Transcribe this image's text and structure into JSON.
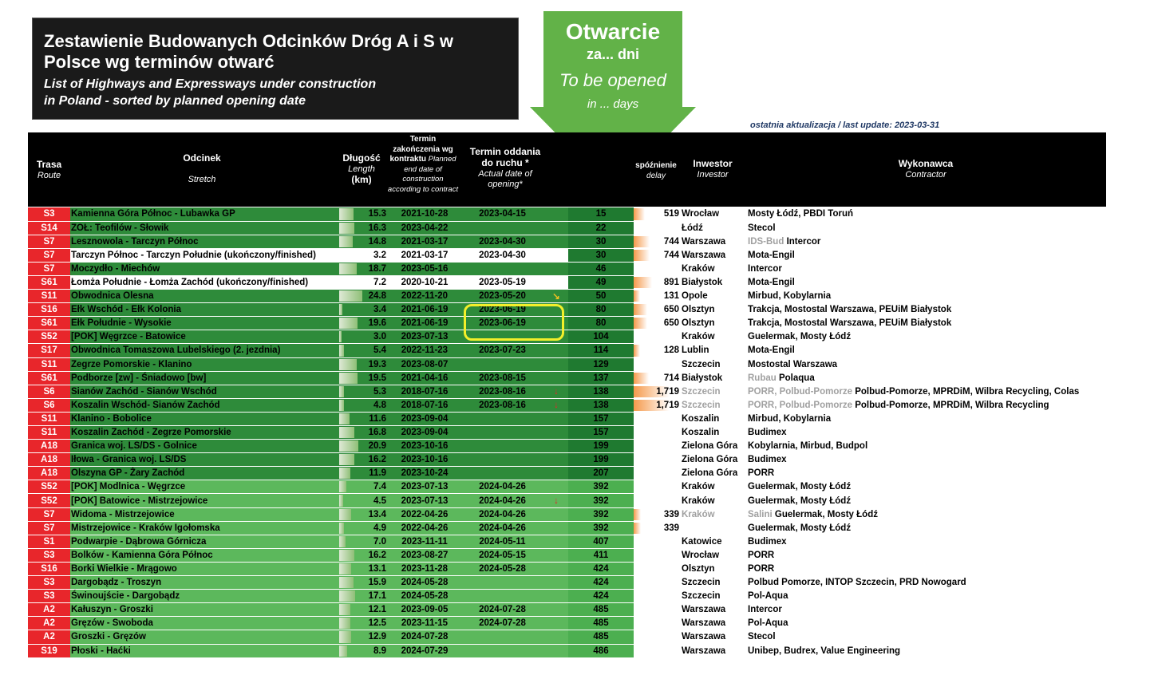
{
  "title": {
    "pl": "Zestawienie Budowanych Odcinków Dróg A i S w Polsce wg terminów otwarć",
    "en_line1": "List of Highways and Expressways under construction",
    "en_line2": "in Poland - sorted by planned opening date"
  },
  "arrow": {
    "line1": "Otwarcie",
    "line2": "za... dni",
    "line3": "To be opened",
    "line4": "in ... days"
  },
  "last_update": "ostatnia aktualizacja / last update: 2023-03-31",
  "headers": {
    "route_pl": "Trasa",
    "route_en": "Route",
    "stretch_pl": "Odcinek",
    "stretch_en": "Stretch",
    "length_pl": "Długość",
    "length_en": "Length",
    "length_unit": "(km)",
    "contract_pl": "Termin zakończenia wg kontraktu",
    "contract_en": "Planned end date of construction according to contract",
    "actual_pl": "Termin oddania do ruchu *",
    "actual_en": "Actual date of opening*",
    "delay_pl": "spóźnienie",
    "delay_en": "delay",
    "investor_pl": "Inwestor",
    "investor_en": "Investor",
    "contractor_pl": "Wykonawca",
    "contractor_en": "Contractor"
  },
  "colors": {
    "route_red": "#e8262b",
    "dark_green": "#2e8b3a",
    "light_green": "#5cb85c",
    "days_dark": "#1f7a30",
    "days_light": "#4caf50",
    "highlight": "#f3ef2a"
  },
  "rows": [
    {
      "route": "S3",
      "stretch": "Kamienna Góra Północ - Lubawka GP",
      "length": "15.3",
      "contract": "2021-10-28",
      "actual": "2023-04-15",
      "mark": "",
      "days": "15",
      "delay": "519",
      "investor": "Wrocław",
      "contractor": "Mosty Łódź, PBDI Toruń",
      "shade": "dark"
    },
    {
      "route": "S14",
      "stretch": "ZOŁ: Teofilów - Słowik",
      "length": "16.3",
      "contract": "2023-04-22",
      "actual": "",
      "mark": "",
      "days": "22",
      "delay": "",
      "investor": "Łódź",
      "contractor": "Stecol",
      "shade": "dark"
    },
    {
      "route": "S7",
      "stretch": "Lesznowola - Tarczyn Północ",
      "length": "14.8",
      "contract": "2021-03-17",
      "actual": "2023-04-30",
      "mark": "",
      "days": "30",
      "delay": "744",
      "investor": "Warszawa",
      "contractor_grey": "IDS-Bud",
      "contractor": "Intercor",
      "shade": "dark"
    },
    {
      "route": "S7",
      "stretch": "Tarczyn Północ - Tarczyn Południe (ukończony/finished)",
      "length": "3.2",
      "contract": "2021-03-17",
      "actual": "2023-04-30",
      "mark": "",
      "days": "30",
      "delay": "744",
      "investor": "Warszawa",
      "contractor": "Mota-Engil",
      "shade": "white"
    },
    {
      "route": "S7",
      "stretch": "Moczydło - Miechów",
      "length": "18.7",
      "contract": "2023-05-16",
      "actual": "",
      "mark": "",
      "days": "46",
      "delay": "",
      "investor": "Kraków",
      "contractor": "Intercor",
      "shade": "dark"
    },
    {
      "route": "S61",
      "stretch": "Łomża Południe - Łomża Zachód (ukończony/finished)",
      "length": "7.2",
      "contract": "2020-10-21",
      "actual": "2023-05-19",
      "mark": "",
      "days": "49",
      "delay": "891",
      "investor": "Białystok",
      "contractor": "Mota-Engil",
      "shade": "white"
    },
    {
      "route": "S11",
      "stretch": "Obwodnica Olesna",
      "length": "24.8",
      "contract": "2022-11-20",
      "actual": "2023-05-20",
      "mark": "↘",
      "days": "50",
      "delay": "131",
      "investor": "Opole",
      "contractor": "Mirbud, Kobylarnia",
      "shade": "dark"
    },
    {
      "route": "S16",
      "stretch": "Ełk Wschód - Ełk Kolonia",
      "length": "3.4",
      "contract": "2021-06-19",
      "actual": "2023-06-19",
      "mark": "",
      "days": "80",
      "delay": "650",
      "investor": "Olsztyn",
      "contractor": "Trakcja, Mostostal Warszawa, PEUiM Białystok",
      "shade": "dark"
    },
    {
      "route": "S61",
      "stretch": "Ełk Południe - Wysokie",
      "length": "19.6",
      "contract": "2021-06-19",
      "actual": "2023-06-19",
      "mark": "",
      "days": "80",
      "delay": "650",
      "investor": "Olsztyn",
      "contractor": "Trakcja, Mostostal Warszawa, PEUiM Białystok",
      "shade": "dark"
    },
    {
      "route": "S52",
      "stretch": "[POK] Węgrzce - Batowice",
      "length": "3.0",
      "contract": "2023-07-13",
      "actual": "",
      "mark": "",
      "days": "104",
      "delay": "",
      "investor": "Kraków",
      "contractor": "Guelermak, Mosty Łódź",
      "shade": "dark"
    },
    {
      "route": "S17",
      "stretch": "Obwodnica Tomaszowa Lubelskiego (2. jezdnia)",
      "length": "5.4",
      "contract": "2022-11-23",
      "actual": "2023-07-23",
      "mark": "",
      "days": "114",
      "delay": "128",
      "investor": "Lublin",
      "contractor": "Mota-Engil",
      "shade": "dark"
    },
    {
      "route": "S11",
      "stretch": "Zegrze Pomorskie - Klanino",
      "length": "19.3",
      "contract": "2023-08-07",
      "actual": "",
      "mark": "",
      "days": "129",
      "delay": "",
      "investor": "Szczecin",
      "contractor": "Mostostal Warszawa",
      "shade": "dark"
    },
    {
      "route": "S61",
      "stretch": "Podborze [zw] - Śniadowo [bw]",
      "length": "19.5",
      "contract": "2021-04-16",
      "actual": "2023-08-15",
      "mark": "",
      "days": "137",
      "delay": "714",
      "investor": "Białystok",
      "contractor_grey": "Rubau",
      "contractor": "Polaqua",
      "shade": "dark"
    },
    {
      "route": "S6",
      "stretch": "Sianów Zachód - Sianów Wschód",
      "length": "5.3",
      "contract": "2018-07-16",
      "actual": "2023-08-16",
      "mark": "↓",
      "days": "138",
      "delay": "1,719",
      "investor_grey": "Szczecin",
      "contractor_grey": "PORR, Polbud-Pomorze",
      "contractor": "Polbud-Pomorze, MPRDiM, Wilbra Recycling, Colas",
      "shade": "dark"
    },
    {
      "route": "S6",
      "stretch": "Koszalin Wschód- Sianów Zachód",
      "length": "4.8",
      "contract": "2018-07-16",
      "actual": "2023-08-16",
      "mark": "↓",
      "days": "138",
      "delay": "1,719",
      "investor_grey": "Szczecin",
      "contractor_grey": "PORR, Polbud-Pomorze",
      "contractor": "Polbud-Pomorze, MPRDiM, Wilbra Recycling",
      "shade": "dark"
    },
    {
      "route": "S11",
      "stretch": "Klanino - Bobolice",
      "length": "11.6",
      "contract": "2023-09-04",
      "actual": "",
      "mark": "",
      "days": "157",
      "delay": "",
      "investor": "Koszalin",
      "contractor": "Mirbud, Kobylarnia",
      "shade": "dark"
    },
    {
      "route": "S11",
      "stretch": "Koszalin Zachód - Zegrze Pomorskie",
      "length": "16.8",
      "contract": "2023-09-04",
      "actual": "",
      "mark": "",
      "days": "157",
      "delay": "",
      "investor": "Koszalin",
      "contractor": "Budimex",
      "shade": "dark"
    },
    {
      "route": "A18",
      "stretch": "Granica woj. LS/DS - Golnice",
      "length": "20.9",
      "contract": "2023-10-16",
      "actual": "",
      "mark": "",
      "days": "199",
      "delay": "",
      "investor": "Zielona Góra",
      "contractor": "Kobylarnia, Mirbud, Budpol",
      "shade": "dark"
    },
    {
      "route": "A18",
      "stretch": "Iłowa - Granica woj. LS/DS",
      "length": "16.2",
      "contract": "2023-10-16",
      "actual": "",
      "mark": "",
      "days": "199",
      "delay": "",
      "investor": "Zielona Góra",
      "contractor": "Budimex",
      "shade": "dark"
    },
    {
      "route": "A18",
      "stretch": "Olszyna GP - Żary Zachód",
      "length": "11.9",
      "contract": "2023-10-24",
      "actual": "",
      "mark": "",
      "days": "207",
      "delay": "",
      "investor": "Zielona Góra",
      "contractor": "PORR",
      "shade": "dark"
    },
    {
      "route": "S52",
      "stretch": "[POK] Modlnica - Węgrzce",
      "length": "7.4",
      "contract": "2023-07-13",
      "actual": "2024-04-26",
      "mark": "",
      "days": "392",
      "delay": "",
      "investor": "Kraków",
      "contractor": "Guelermak, Mosty Łódź",
      "shade": "light"
    },
    {
      "route": "S52",
      "stretch": "[POK] Batowice - Mistrzejowice",
      "length": "4.5",
      "contract": "2023-07-13",
      "actual": "2024-04-26",
      "mark": "↓",
      "days": "392",
      "delay": "",
      "investor": "Kraków",
      "contractor": "Guelermak, Mosty Łódź",
      "shade": "light"
    },
    {
      "route": "S7",
      "stretch": "Widoma - Mistrzejowice",
      "length": "13.4",
      "contract": "2022-04-26",
      "actual": "2024-04-26",
      "mark": "",
      "days": "392",
      "delay": "339",
      "investor_grey": "Kraków",
      "contractor_grey": "Salini",
      "contractor": "Guelermak, Mosty Łódź",
      "shade": "light"
    },
    {
      "route": "S7",
      "stretch": "Mistrzejowice - Kraków Igołomska",
      "length": "4.9",
      "contract": "2022-04-26",
      "actual": "2024-04-26",
      "mark": "",
      "days": "392",
      "delay": "339",
      "investor": "",
      "contractor": "Guelermak, Mosty Łódź",
      "shade": "light"
    },
    {
      "route": "S1",
      "stretch": "Podwarpie - Dąbrowa Górnicza",
      "length": "7.0",
      "contract": "2023-11-11",
      "actual": "2024-05-11",
      "mark": "",
      "days": "407",
      "delay": "",
      "investor": "Katowice",
      "contractor": "Budimex",
      "shade": "light"
    },
    {
      "route": "S3",
      "stretch": "Bolków - Kamienna Góra Północ",
      "length": "16.2",
      "contract": "2023-08-27",
      "actual": "2024-05-15",
      "mark": "",
      "days": "411",
      "delay": "",
      "investor": "Wrocław",
      "contractor": "PORR",
      "shade": "light"
    },
    {
      "route": "S16",
      "stretch": "Borki Wielkie - Mrągowo",
      "length": "13.1",
      "contract": "2023-11-28",
      "actual": "2024-05-28",
      "mark": "",
      "days": "424",
      "delay": "",
      "investor": "Olsztyn",
      "contractor": "PORR",
      "shade": "light"
    },
    {
      "route": "S3",
      "stretch": "Dargobądz - Troszyn",
      "length": "15.9",
      "contract": "2024-05-28",
      "actual": "",
      "mark": "",
      "days": "424",
      "delay": "",
      "investor": "Szczecin",
      "contractor": "Polbud Pomorze, INTOP Szczecin, PRD Nowogard",
      "shade": "light"
    },
    {
      "route": "S3",
      "stretch": "Świnoujście - Dargobądz",
      "length": "17.1",
      "contract": "2024-05-28",
      "actual": "",
      "mark": "",
      "days": "424",
      "delay": "",
      "investor": "Szczecin",
      "contractor": "Pol-Aqua",
      "shade": "light"
    },
    {
      "route": "A2",
      "stretch": "Kałuszyn - Groszki",
      "length": "12.1",
      "contract": "2023-09-05",
      "actual": "2024-07-28",
      "mark": "",
      "days": "485",
      "delay": "",
      "investor": "Warszawa",
      "contractor": "Intercor",
      "shade": "light"
    },
    {
      "route": "A2",
      "stretch": "Gręzów - Swoboda",
      "length": "12.5",
      "contract": "2023-11-15",
      "actual": "2024-07-28",
      "mark": "",
      "days": "485",
      "delay": "",
      "investor": "Warszawa",
      "contractor": "Pol-Aqua",
      "shade": "light"
    },
    {
      "route": "A2",
      "stretch": "Groszki - Gręzów",
      "length": "12.9",
      "contract": "2024-07-28",
      "actual": "",
      "mark": "",
      "days": "485",
      "delay": "",
      "investor": "Warszawa",
      "contractor": "Stecol",
      "shade": "light"
    },
    {
      "route": "S19",
      "stretch": "Płoski - Haćki",
      "length": "8.9",
      "contract": "2024-07-29",
      "actual": "",
      "mark": "",
      "days": "486",
      "delay": "",
      "investor": "Warszawa",
      "contractor": "Unibep, Budrex, Value Engineering",
      "shade": "light"
    }
  ]
}
